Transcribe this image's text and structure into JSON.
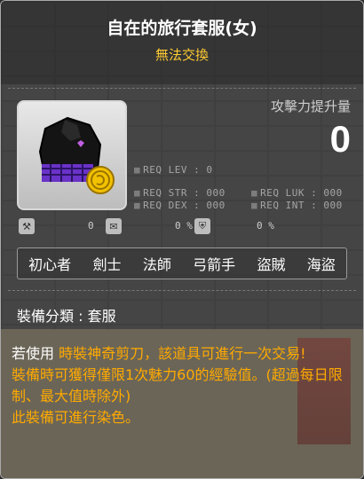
{
  "item": {
    "name": "自在的旅行套服(女)",
    "trade_status": "無法交換"
  },
  "attack": {
    "label": "攻擊力提升量",
    "value": "0"
  },
  "requirements": {
    "lev": "REQ LEV :  0",
    "str": "REQ STR : 000",
    "dex": "REQ DEX : 000",
    "luk": "REQ LUK : 000",
    "int": "REQ INT : 000"
  },
  "stats": {
    "stat1_value": "0",
    "stat2_value": "0 %",
    "stat3_value": "0 %"
  },
  "jobs": [
    "初心者",
    "劍士",
    "法師",
    "弓箭手",
    "盜賊",
    "海盜"
  ],
  "category": {
    "text": "裝備分類 : 套服"
  },
  "description": {
    "line1_prefix": "若使用 ",
    "line1_highlight": "時裝神奇剪刀，該道具可進行一次交易!",
    "line2": " 裝備時可獲得僅限1次魅力60的經驗值。(超過每日限制、最大值時除外)",
    "line3": " 此裝備可進行染色。"
  },
  "colors": {
    "title": "#ffffff",
    "subtitle": "#ffcc33",
    "highlight": "#ffaa00"
  }
}
